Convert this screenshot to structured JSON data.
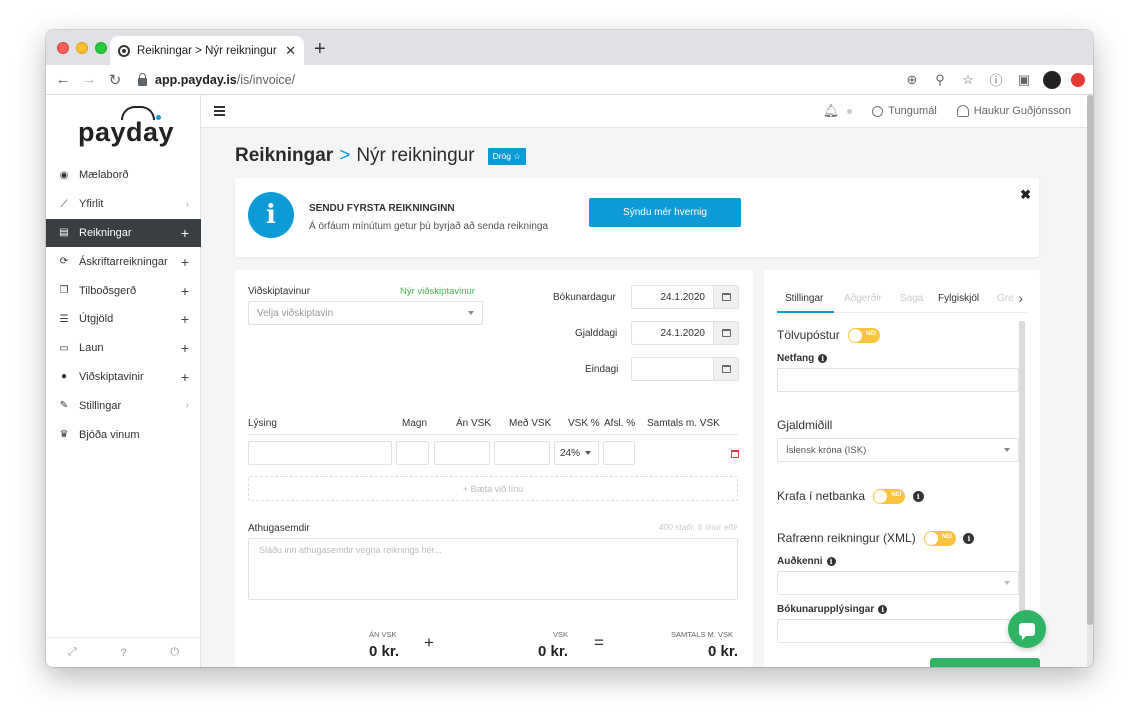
{
  "browser": {
    "tab_title": "Reikningar > Nýr reikningur - P",
    "url_host": "app.payday.is",
    "url_path": "/is/invoice/"
  },
  "sidebar": {
    "logo": "payday",
    "items": [
      {
        "label": "Mælaborð",
        "icon": "dashboard-icon",
        "right": ""
      },
      {
        "label": "Yfirlit",
        "icon": "chart-icon",
        "right": "›"
      },
      {
        "label": "Reikningar",
        "icon": "invoice-icon",
        "right": "+"
      },
      {
        "label": "Áskriftarreikningar",
        "icon": "refresh-icon",
        "right": "+"
      },
      {
        "label": "Tilboðsgerð",
        "icon": "copy-icon",
        "right": "+"
      },
      {
        "label": "Útgjöld",
        "icon": "receipt-icon",
        "right": "+"
      },
      {
        "label": "Laun",
        "icon": "wallet-icon",
        "right": "+"
      },
      {
        "label": "Viðskiptavinir",
        "icon": "user-icon",
        "right": "+"
      },
      {
        "label": "Stillingar",
        "icon": "wrench-icon",
        "right": "›"
      },
      {
        "label": "Bjóða vinum",
        "icon": "trophy-icon",
        "right": ""
      }
    ]
  },
  "topbar": {
    "language": "Tungumál",
    "user": "Haukur Guðjónsson"
  },
  "page": {
    "crumb1": "Reikningar",
    "crumb_sep": ">",
    "crumb2": "Nýr reikningur",
    "badge": "Drög ☆"
  },
  "info": {
    "heading": "SENDU FYRSTA REIKNINGINN",
    "sub": "Á örfáum mínútum getur þú byrjað að senda reikninga",
    "button": "Sýndu mér hvernig"
  },
  "invoice": {
    "customer_label": "Viðskiptavinur",
    "new_customer": "Nýr viðskiptavinur",
    "customer_placeholder": "Velja viðskiptavin",
    "booking_date_label": "Bókunardagur",
    "booking_date": "24.1.2020",
    "due_date_label": "Gjalddagi",
    "due_date": "24.1.2020",
    "final_date_label": "Eindagi",
    "final_date": "",
    "columns": [
      "Lýsing",
      "Magn",
      "Án VSK",
      "Með VSK",
      "VSK %",
      "Afsl. %",
      "Samtals m. VSK"
    ],
    "vat_value": "24%",
    "add_line": "+ Bæta við línu",
    "notes_label": "Athugasemdir",
    "notes_limit": "400 stafir, 6 línur eftir",
    "notes_placeholder": "Sláðu inn athugasemdir vegna reiknings hér...",
    "totals": {
      "net_label": "ÁN VSK",
      "net_value": "0 kr.",
      "plus": "+",
      "vat_label": "VSK",
      "vat_value": "0 kr.",
      "equals": "=",
      "gross_label": "SAMTALS M. VSK",
      "gross_value": "0 kr."
    }
  },
  "settings": {
    "tabs": [
      "Stillingar",
      "Aðgerðir",
      "Saga",
      "Fylgiskjöl",
      "Gre"
    ],
    "email_label": "Tölvupóstur",
    "toggle_text": "NEI",
    "address_label": "Netfang",
    "currency_label": "Gjaldmiðill",
    "currency_value": "Íslensk króna (ISK)",
    "bank_claim_label": "Krafa í netbanka",
    "xml_label": "Rafrænn reikningur (XML)",
    "identifier_label": "Auðkenni",
    "booking_info_label": "Bókunarupplýsingar"
  },
  "colors": {
    "accent": "#0d9bd8",
    "toggle": "#fcc43e",
    "success": "#2fb463",
    "sidebar_active": "#3a3d42"
  }
}
